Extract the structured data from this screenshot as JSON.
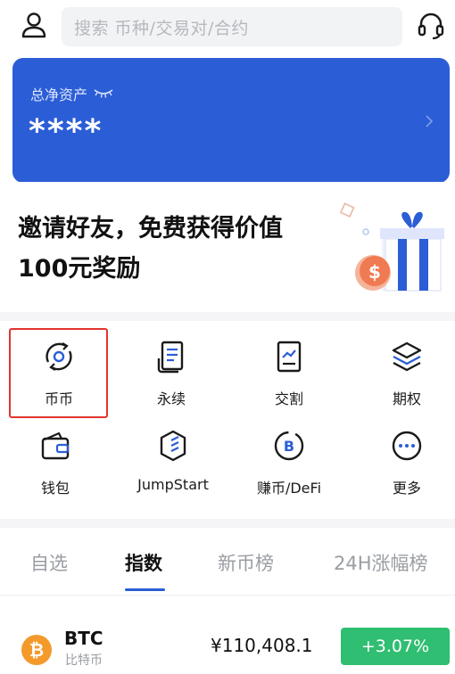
{
  "search": {
    "placeholder": "搜索 币种/交易对/合约"
  },
  "asset": {
    "label": "总净资产",
    "value": "****"
  },
  "invite": {
    "text": "邀请好友，免费获得价值100元奖励",
    "coin_symbol": "$"
  },
  "grid": [
    {
      "label": "币币",
      "icon": "swap-cycle-icon"
    },
    {
      "label": "永续",
      "icon": "contract-doc-icon"
    },
    {
      "label": "交割",
      "icon": "chart-doc-icon"
    },
    {
      "label": "期权",
      "icon": "layers-icon"
    },
    {
      "label": "钱包",
      "icon": "wallet-icon"
    },
    {
      "label": "JumpStart",
      "icon": "jumpstart-icon"
    },
    {
      "label": "赚币/DeFi",
      "icon": "bitcoin-coin-icon"
    },
    {
      "label": "更多",
      "icon": "more-dots-icon"
    }
  ],
  "tabs": [
    {
      "label": "自选",
      "active": false
    },
    {
      "label": "指数",
      "active": true
    },
    {
      "label": "新币榜",
      "active": false
    },
    {
      "label": "24H涨幅榜",
      "active": false
    }
  ],
  "market": [
    {
      "symbol": "BTC",
      "name": "比特币",
      "price": "¥110,408.1",
      "change": "+3.07%",
      "change_color": "#2fbe72",
      "icon_glyph": "₿"
    }
  ],
  "colors": {
    "accent": "#2b5dd6",
    "highlight": "#e3342f",
    "up": "#2fbe72"
  }
}
